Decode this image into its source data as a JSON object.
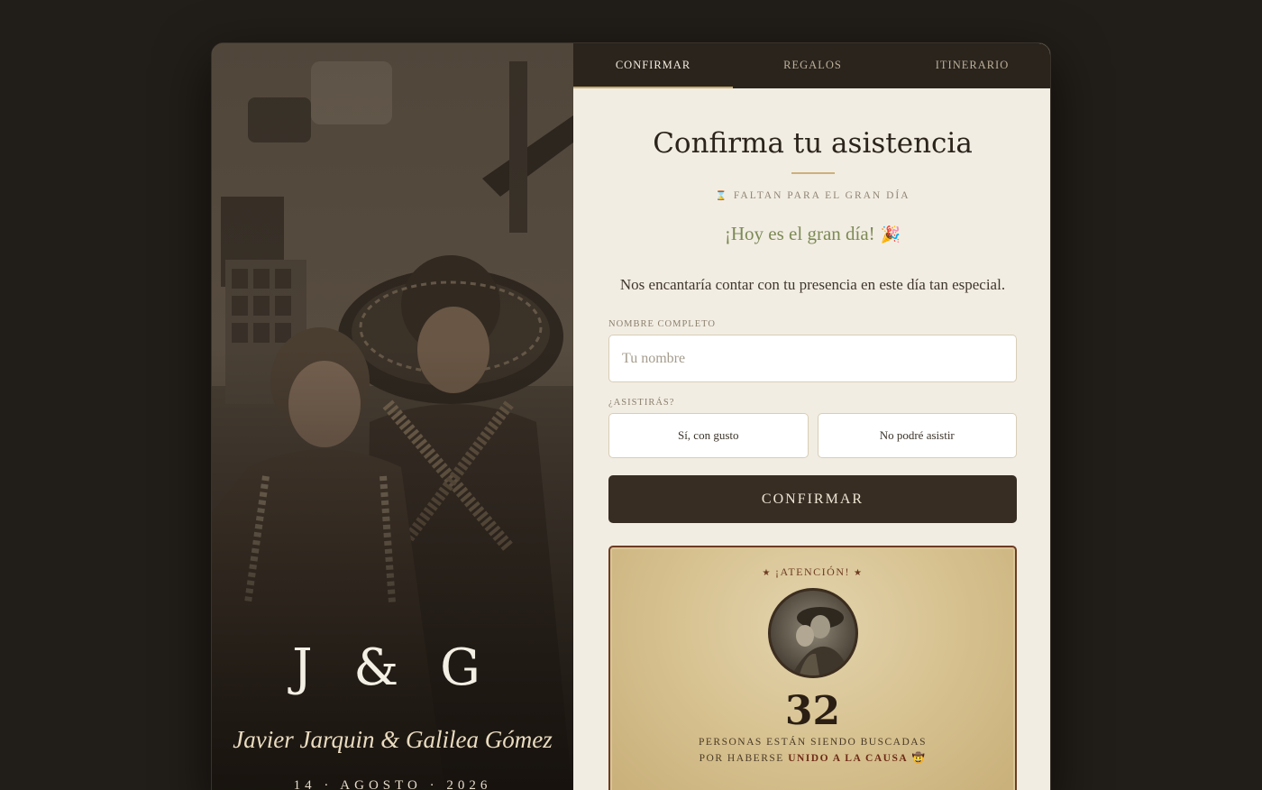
{
  "tabs": [
    {
      "label": "CONFIRMAR",
      "active": true
    },
    {
      "label": "REGALOS",
      "active": false
    },
    {
      "label": "ITINERARIO",
      "active": false
    }
  ],
  "hero": {
    "monogram": "J & G",
    "names": "Javier Jarquin & Galilea Gómez",
    "date": "14 · AGOSTO · 2026"
  },
  "rsvp": {
    "heading": "Confirma tu asistencia",
    "countdown_icon": "hourglass-icon",
    "countdown_label": "FALTAN PARA EL GRAN DÍA",
    "big_day": "¡Hoy es el gran día!",
    "big_day_emoji": "🎉",
    "intro": "Nos encantaría contar con tu presencia en este día tan especial.",
    "name_label": "NOMBRE COMPLETO",
    "name_placeholder": "Tu nombre",
    "name_value": "",
    "attend_label": "¿ASISTIRÁS?",
    "yes_label": "Sí, con gusto",
    "no_label": "No podré asistir",
    "confirm_label": "CONFIRMAR"
  },
  "notice": {
    "title": "¡ATENCIÓN!",
    "count": "32",
    "line1": "PERSONAS ESTÁN SIENDO BUSCADAS",
    "line2_prefix": "POR HABERSE",
    "line2_cause": "UNIDO A LA CAUSA",
    "line2_emoji": "🤠"
  },
  "colors": {
    "background": "#211d18",
    "tab_bar": "#2a241d",
    "accent_gold": "#c7a96a",
    "button": "#372d23",
    "panel": "#f2ede3",
    "olive": "#7c8a55",
    "notice_border": "#6e3c22"
  }
}
